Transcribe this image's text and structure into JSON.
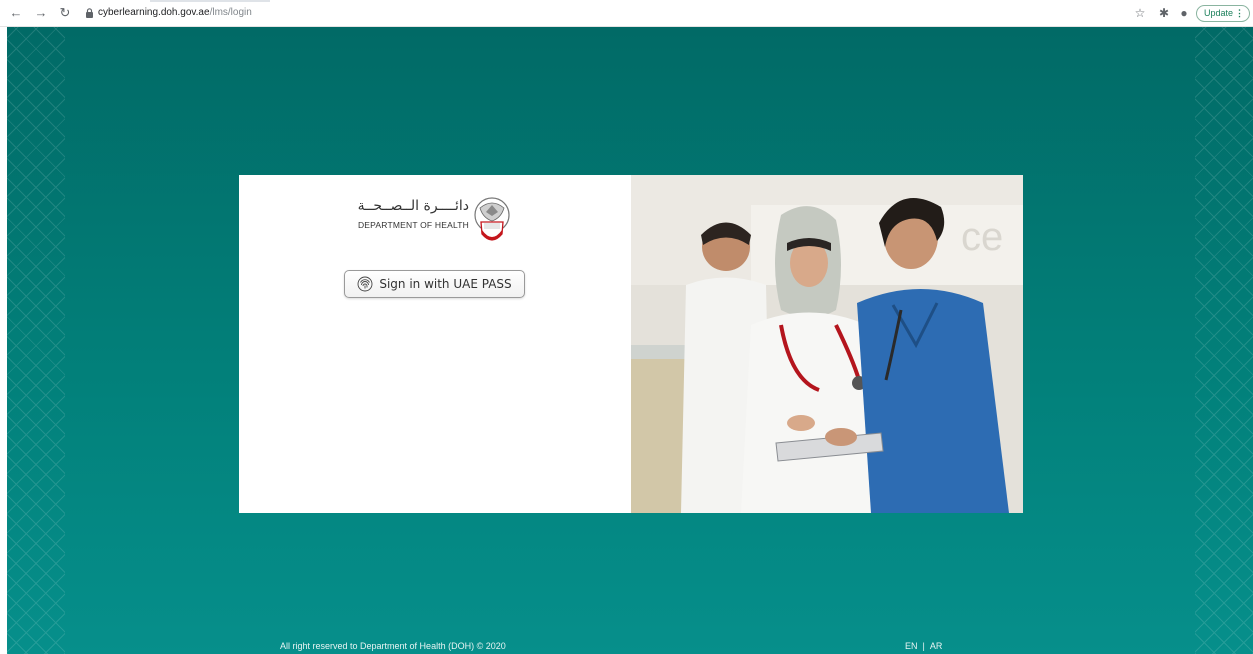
{
  "browser": {
    "url_host": "cyberlearning.doh.gov.ae",
    "url_path": "/lms/login",
    "update_label": "Update"
  },
  "login": {
    "logo_arabic": "دائــــرة الــصــحــة",
    "logo_english": "DEPARTMENT OF HEALTH",
    "signin_label": "Sign in with UAE PASS"
  },
  "footer": {
    "copyright": "All right reserved to Department of Health (DOH) © 2020",
    "lang_en": "EN",
    "lang_sep": "|",
    "lang_ar": "AR"
  },
  "colors": {
    "background": "#02807a",
    "card": "#ffffff",
    "button_border": "#9a9a9a"
  },
  "icons": {
    "back": "back-arrow-icon",
    "forward": "forward-arrow-icon",
    "reload": "reload-icon",
    "lock": "lock-icon",
    "star": "star-icon",
    "extensions": "puzzle-icon",
    "profile": "profile-icon",
    "fingerprint": "fingerprint-icon",
    "emblem": "abu-dhabi-emblem-icon"
  }
}
